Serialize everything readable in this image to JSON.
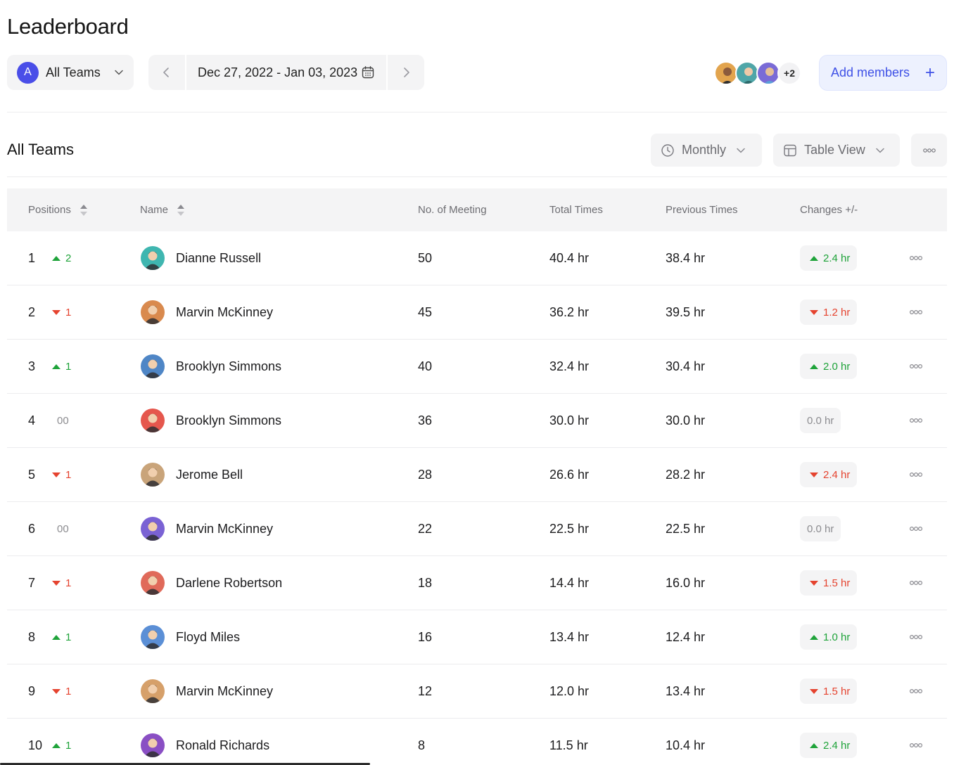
{
  "header": {
    "title": "Leaderboard",
    "team_select": {
      "initial": "A",
      "label": "All Teams"
    },
    "date_range": "Dec 27, 2022 - Jan 03, 2023",
    "members_more": "+2",
    "add_members_label": "Add members",
    "add_members_plus": "+"
  },
  "section": {
    "title": "All Teams",
    "period_label": "Monthly",
    "view_label": "Table View"
  },
  "table": {
    "columns": {
      "positions": "Positions",
      "name": "Name",
      "meetings": "No. of Meeting",
      "total": "Total Times",
      "previous": "Previous Times",
      "changes": "Changes +/-"
    },
    "rows": [
      {
        "position": "1",
        "trend": "up",
        "trend_value": "2",
        "name": "Dianne Russell",
        "meetings": "50",
        "total": "40.4 hr",
        "previous": "38.4 hr",
        "change_dir": "up",
        "change": "2.4 hr",
        "avatar_color": "#3fb6b0"
      },
      {
        "position": "2",
        "trend": "down",
        "trend_value": "1",
        "name": "Marvin McKinney",
        "meetings": "45",
        "total": "36.2 hr",
        "previous": "39.5 hr",
        "change_dir": "down",
        "change": "1.2 hr",
        "avatar_color": "#d98a4e"
      },
      {
        "position": "3",
        "trend": "up",
        "trend_value": "1",
        "name": "Brooklyn Simmons",
        "meetings": "40",
        "total": "32.4 hr",
        "previous": "30.4 hr",
        "change_dir": "up",
        "change": "2.0 hr",
        "avatar_color": "#4f86c6"
      },
      {
        "position": "4",
        "trend": "same",
        "trend_value": "00",
        "name": "Brooklyn Simmons",
        "meetings": "36",
        "total": "30.0 hr",
        "previous": "30.0 hr",
        "change_dir": "same",
        "change": "0.0 hr",
        "avatar_color": "#e5574d"
      },
      {
        "position": "5",
        "trend": "down",
        "trend_value": "1",
        "name": "Jerome Bell",
        "meetings": "28",
        "total": "26.6 hr",
        "previous": "28.2 hr",
        "change_dir": "down",
        "change": "2.4 hr",
        "avatar_color": "#c9a47a"
      },
      {
        "position": "6",
        "trend": "same",
        "trend_value": "00",
        "name": "Marvin McKinney",
        "meetings": "22",
        "total": "22.5 hr",
        "previous": "22.5 hr",
        "change_dir": "same",
        "change": "0.0 hr",
        "avatar_color": "#7a62d4"
      },
      {
        "position": "7",
        "trend": "down",
        "trend_value": "1",
        "name": "Darlene Robertson",
        "meetings": "18",
        "total": "14.4 hr",
        "previous": "16.0 hr",
        "change_dir": "down",
        "change": "1.5 hr",
        "avatar_color": "#e06a5a"
      },
      {
        "position": "8",
        "trend": "up",
        "trend_value": "1",
        "name": "Floyd Miles",
        "meetings": "16",
        "total": "13.4 hr",
        "previous": "12.4 hr",
        "change_dir": "up",
        "change": "1.0 hr",
        "avatar_color": "#5b8fd6"
      },
      {
        "position": "9",
        "trend": "down",
        "trend_value": "1",
        "name": "Marvin McKinney",
        "meetings": "12",
        "total": "12.0 hr",
        "previous": "13.4 hr",
        "change_dir": "down",
        "change": "1.5 hr",
        "avatar_color": "#d6a06a"
      },
      {
        "position": "10",
        "trend": "up",
        "trend_value": "1",
        "name": "Ronald Richards",
        "meetings": "8",
        "total": "11.5 hr",
        "previous": "10.4 hr",
        "change_dir": "up",
        "change": "2.4 hr",
        "avatar_color": "#8a4fc4"
      }
    ]
  },
  "colors": {
    "accent": "#4a4ee8",
    "up": "#1fa33a",
    "down": "#e5432f",
    "neutral": "#8c8c90",
    "add_button_bg": "#edf1fe"
  }
}
